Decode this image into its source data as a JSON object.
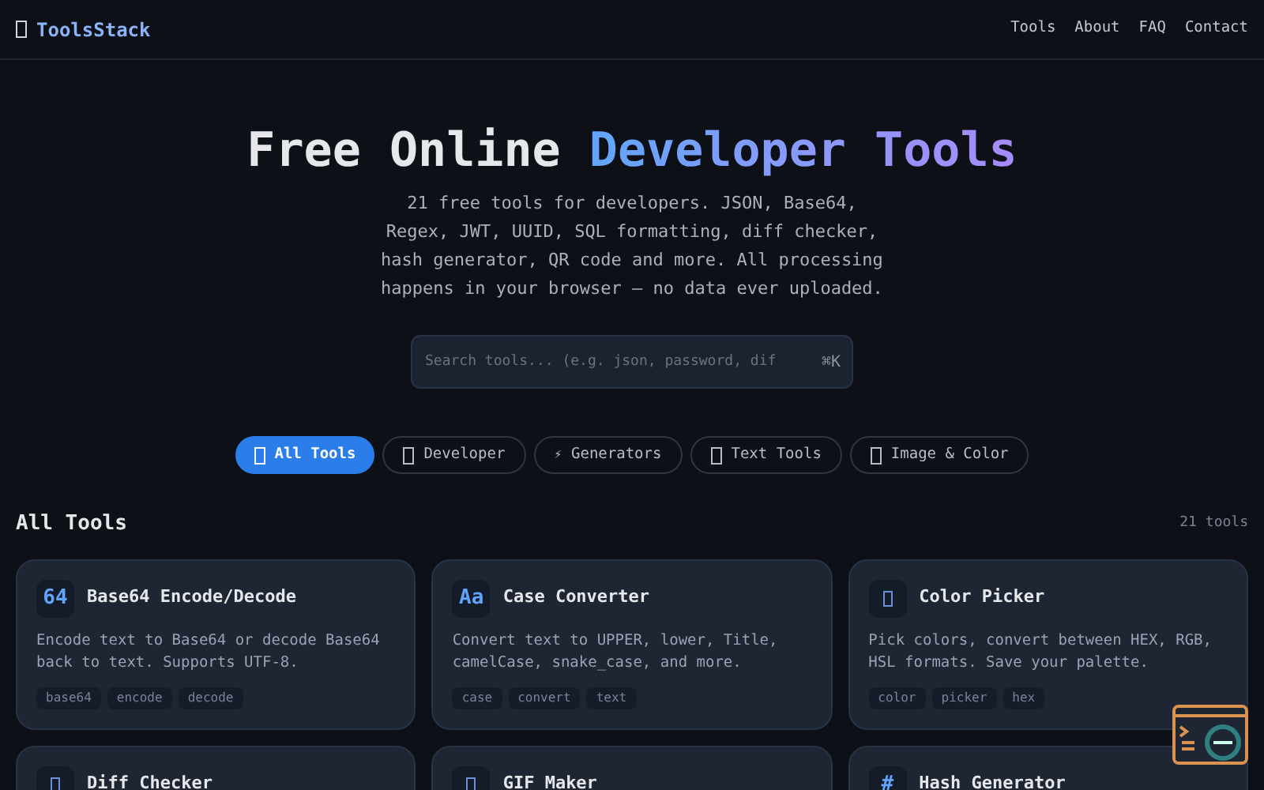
{
  "header": {
    "logo": "ToolsStack",
    "nav": [
      "Tools",
      "About",
      "FAQ",
      "Contact"
    ]
  },
  "hero": {
    "title_plain": "Free Online ",
    "title_accent": "Developer Tools",
    "subtitle": "21 free tools for developers. JSON, Base64, Regex, JWT, UUID, SQL formatting, diff checker, hash generator, QR code and more. All processing happens in your browser — no data ever uploaded."
  },
  "search": {
    "placeholder": "Search tools... (e.g. json, password, dif",
    "shortcut": "⌘K"
  },
  "filters": [
    {
      "label": "All Tools",
      "selected": true
    },
    {
      "label": "Developer",
      "selected": false
    },
    {
      "label": "Generators",
      "glyph": "⚡",
      "selected": false
    },
    {
      "label": "Text Tools",
      "selected": false
    },
    {
      "label": "Image & Color",
      "selected": false
    }
  ],
  "section": {
    "title": "All Tools",
    "count": "21 tools"
  },
  "tools": [
    {
      "badge": "64",
      "name": "Base64 Encode/Decode",
      "description": "Encode text to Base64 or decode Base64 back to text. Supports UTF-8.",
      "tags": [
        "base64",
        "encode",
        "decode"
      ]
    },
    {
      "badge": "Aa",
      "name": "Case Converter",
      "description": "Convert text to UPPER, lower, Title, camelCase, snake_case, and more.",
      "tags": [
        "case",
        "convert",
        "text"
      ]
    },
    {
      "name": "Color Picker",
      "description": "Pick colors, convert between HEX, RGB, HSL formats. Save your palette.",
      "tags": [
        "color",
        "picker",
        "hex"
      ]
    },
    {
      "name": "Diff Checker"
    },
    {
      "name": "GIF Maker"
    },
    {
      "badge": "#",
      "name": "Hash Generator"
    }
  ]
}
